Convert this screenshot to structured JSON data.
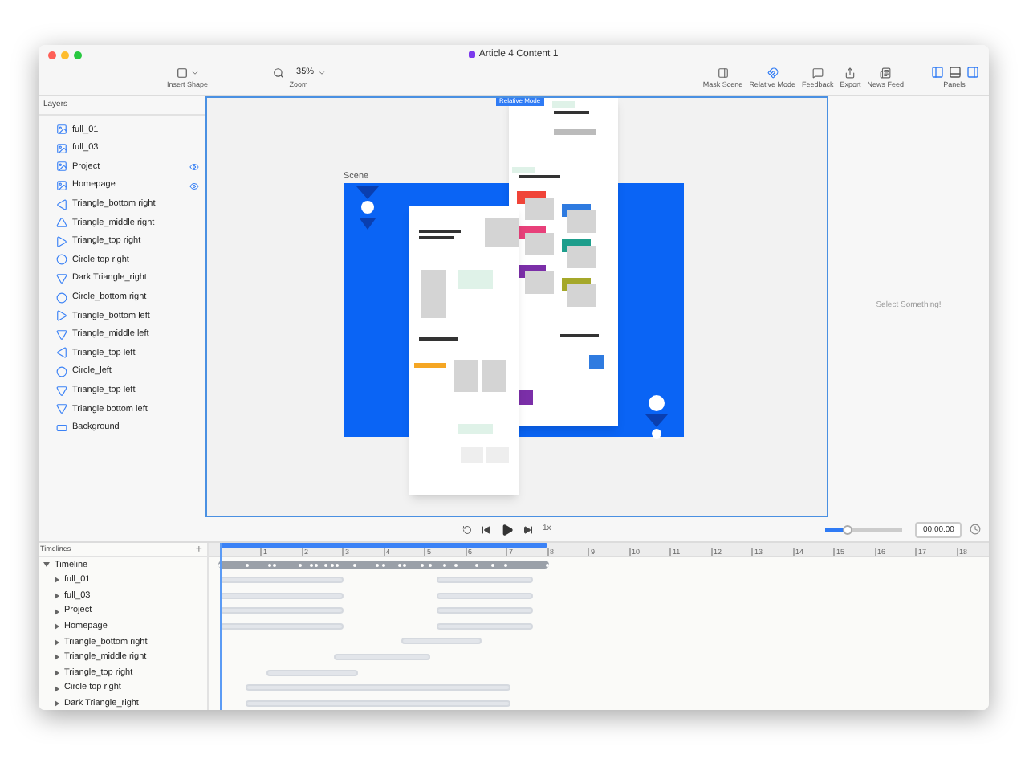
{
  "window": {
    "title": "Article 4 Content 1"
  },
  "toolbar": {
    "left": [
      {
        "kind": "shape",
        "label": "Insert Shape"
      },
      {
        "kind": "zoom",
        "label": "Zoom",
        "value": "35%"
      }
    ],
    "right": [
      {
        "kind": "mask",
        "label": "Mask Scene",
        "active": false
      },
      {
        "kind": "magnet",
        "label": "Relative Mode",
        "active": true
      },
      {
        "kind": "feedback",
        "label": "Feedback",
        "active": false
      },
      {
        "kind": "export",
        "label": "Export",
        "active": false
      },
      {
        "kind": "news",
        "label": "News Feed",
        "active": false
      }
    ],
    "panels": {
      "label": "Panels",
      "buttons": [
        {
          "kind": "left",
          "selected": true
        },
        {
          "kind": "bottom",
          "selected": false
        },
        {
          "kind": "right",
          "selected": true
        }
      ]
    }
  },
  "layers": {
    "title": "Layers",
    "items": [
      {
        "kind": "image",
        "label": "full_01",
        "visible": false
      },
      {
        "kind": "image",
        "label": "full_03",
        "visible": false
      },
      {
        "kind": "image",
        "label": "Project",
        "visible": true
      },
      {
        "kind": "image",
        "label": "Homepage",
        "visible": true
      },
      {
        "kind": "triangle-left",
        "label": "Triangle_bottom right",
        "visible": false
      },
      {
        "kind": "triangle-up",
        "label": "Triangle_middle right",
        "visible": false
      },
      {
        "kind": "triangle-right",
        "label": "Triangle_top right",
        "visible": false
      },
      {
        "kind": "circle",
        "label": "Circle top right",
        "visible": false
      },
      {
        "kind": "triangle-down",
        "label": "Dark Triangle_right",
        "visible": false
      },
      {
        "kind": "circle",
        "label": "Circle_bottom right",
        "visible": false
      },
      {
        "kind": "triangle-right",
        "label": "Triangle_bottom left",
        "visible": false
      },
      {
        "kind": "triangle-down",
        "label": "Triangle_middle left",
        "visible": false
      },
      {
        "kind": "triangle-left",
        "label": "Triangle_top left",
        "visible": false
      },
      {
        "kind": "circle",
        "label": "Circle_left",
        "visible": false
      },
      {
        "kind": "triangle-down",
        "label": "Triangle_top left",
        "visible": false
      },
      {
        "kind": "triangle-down",
        "label": "Triangle bottom left",
        "visible": false
      },
      {
        "kind": "rect",
        "label": "Background",
        "visible": false
      }
    ]
  },
  "canvas": {
    "badge": "Relative Mode",
    "scene_label": "Scene"
  },
  "inspector": {
    "empty_text": "Select Something!"
  },
  "playback": {
    "speed": "1x",
    "level": 0.3,
    "time": "00:00.00"
  },
  "timelines": {
    "title": "Timelines",
    "add": "+",
    "ruler": [
      "1",
      "2",
      "3",
      "4",
      "5",
      "6",
      "7",
      "8",
      "9",
      "10",
      "11",
      "12",
      "13",
      "14",
      "15",
      "16",
      "17",
      "18"
    ],
    "tree": {
      "label": "Timeline",
      "expanded": true,
      "children": [
        {
          "label": "full_01",
          "expanded": false
        },
        {
          "label": "full_03",
          "expanded": false
        },
        {
          "label": "Project",
          "expanded": false
        },
        {
          "label": "Homepage",
          "expanded": false
        },
        {
          "label": "Triangle_bottom right",
          "expanded": false
        },
        {
          "label": "Triangle_middle right",
          "expanded": false
        },
        {
          "label": "Triangle_top right",
          "expanded": false
        },
        {
          "label": "Circle top right",
          "expanded": false
        },
        {
          "label": "Dark Triangle_right",
          "expanded": false
        }
      ]
    }
  }
}
